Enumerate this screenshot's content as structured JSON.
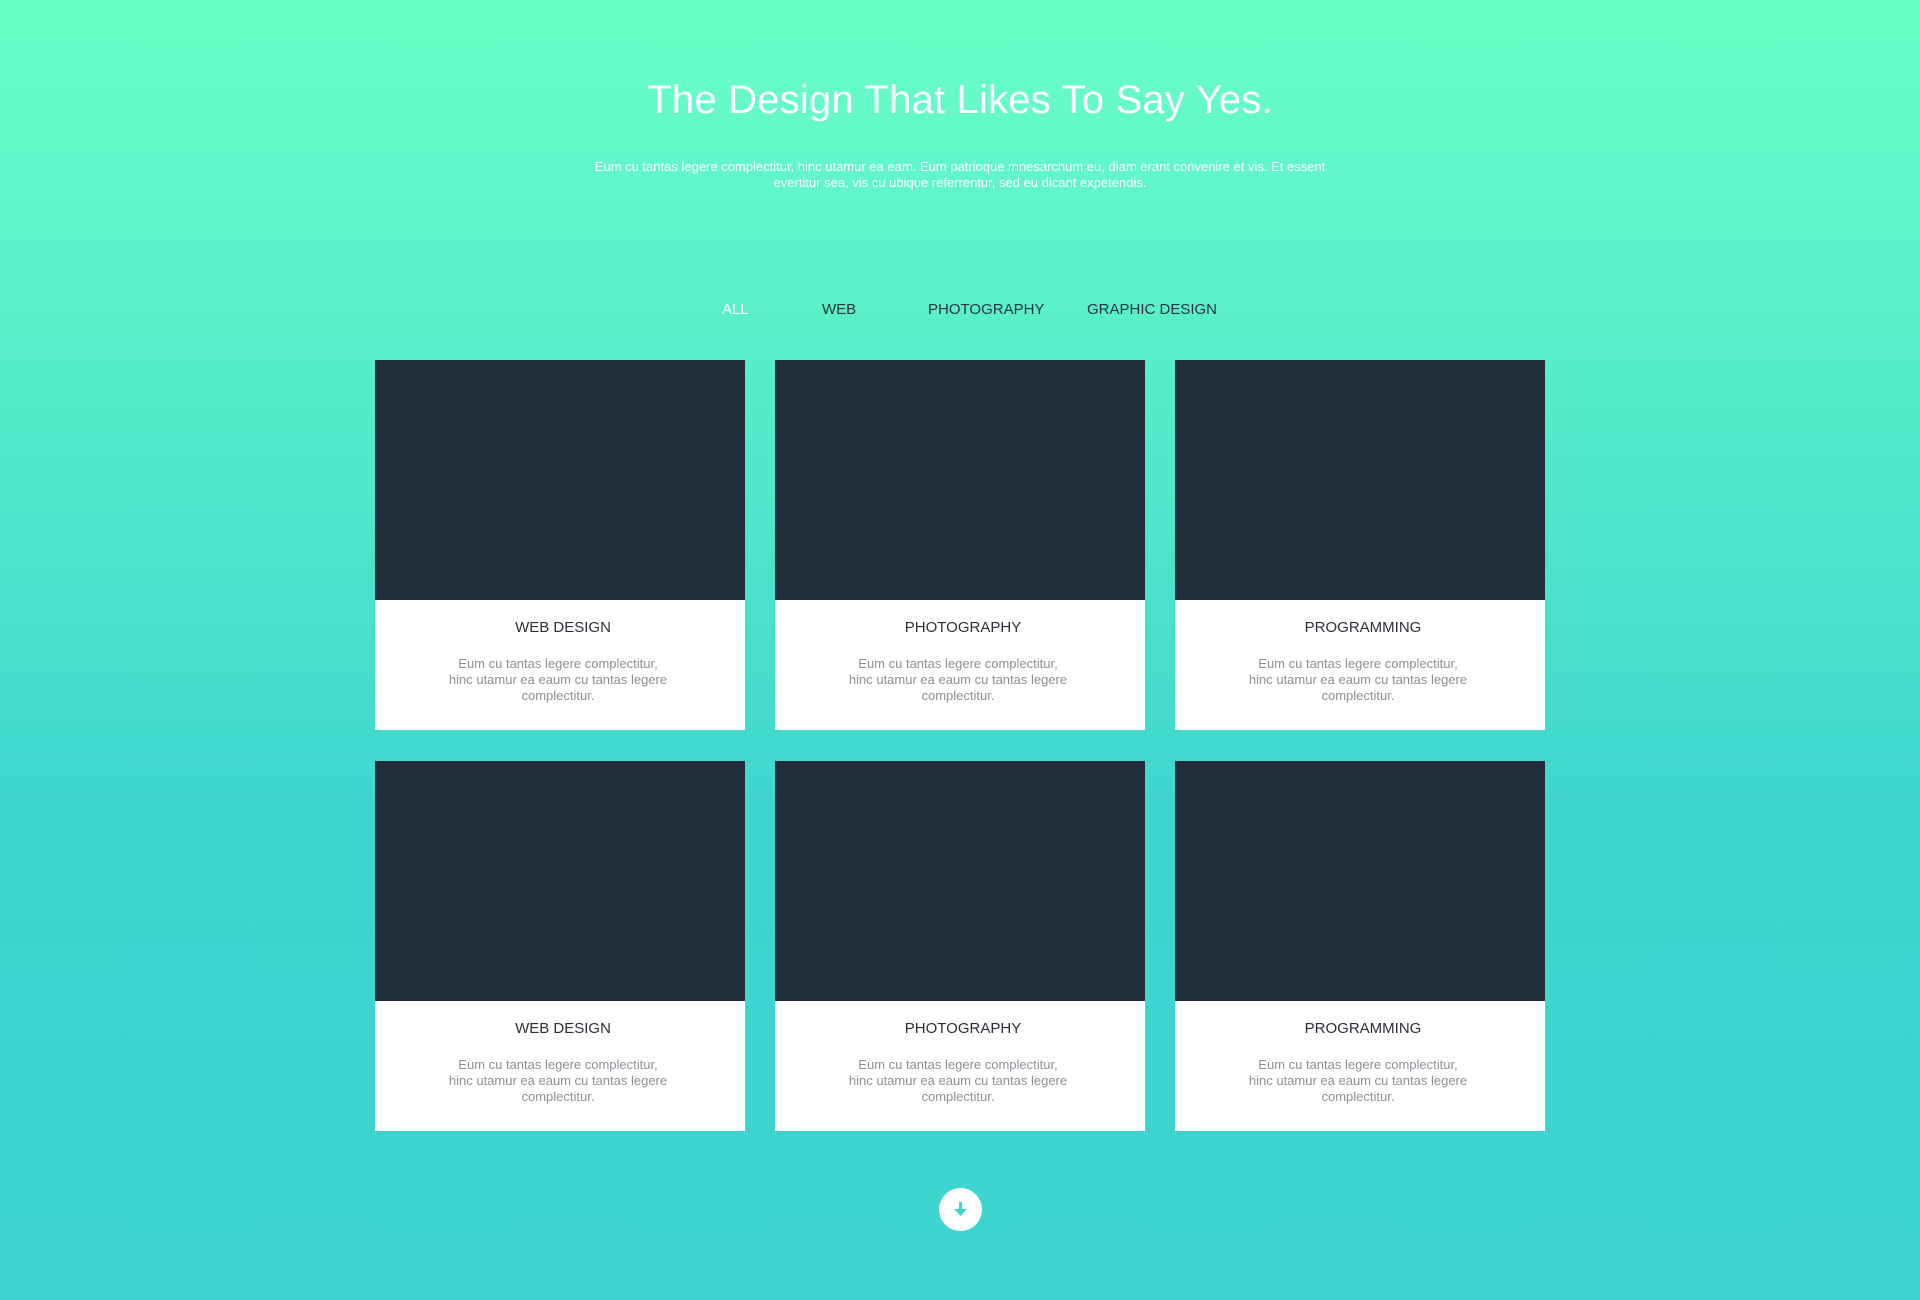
{
  "hero": {
    "title": "The Design That Likes To Say Yes.",
    "text": "Eum cu tantas legere complectitur, hinc utamur ea eam. Eum patrioque mnesarchum eu, diam erant convenire et vis. Et essent evertitur sea, vis cu ubique referrentur, sed eu dicant expetendis."
  },
  "filters": [
    {
      "label": "ALL",
      "active": true
    },
    {
      "label": "WEB",
      "active": false
    },
    {
      "label": "PHOTOGRAPHY",
      "active": false
    },
    {
      "label": "GRAPHIC DESIGN",
      "active": false
    }
  ],
  "cards": [
    {
      "title": "WEB DESIGN",
      "desc": "Eum cu tantas legere complectitur, hinc utamur ea eaum cu tantas legere complectitur."
    },
    {
      "title": "PHOTOGRAPHY",
      "desc": "Eum cu tantas legere complectitur, hinc utamur ea eaum cu tantas legere complectitur."
    },
    {
      "title": "PROGRAMMING",
      "desc": "Eum cu tantas legere complectitur, hinc utamur ea eaum cu tantas legere complectitur."
    },
    {
      "title": "WEB DESIGN",
      "desc": "Eum cu tantas legere complectitur, hinc utamur ea eaum cu tantas legere complectitur."
    },
    {
      "title": "PHOTOGRAPHY",
      "desc": "Eum cu tantas legere complectitur, hinc utamur ea eaum cu tantas legere complectitur."
    },
    {
      "title": "PROGRAMMING",
      "desc": "Eum cu tantas legere complectitur, hinc utamur ea eaum cu tantas legere complectitur."
    }
  ],
  "scroll_button": {
    "icon": "arrow-down-icon"
  },
  "colors": {
    "background_top": "#6bffc8",
    "background_bottom": "#3ed3d0",
    "card_image": "#222d3c",
    "accent": "#3ed3d0"
  }
}
